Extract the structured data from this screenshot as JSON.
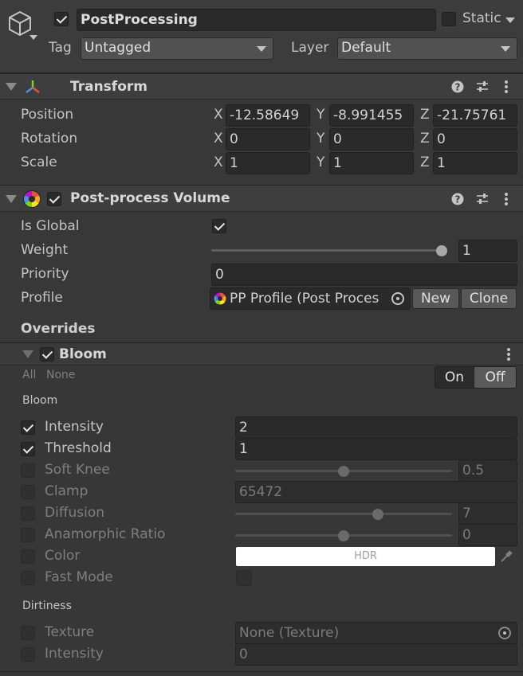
{
  "gameobject": {
    "name": "PostProcessing",
    "active": true,
    "static_label": "Static",
    "static_checked": false,
    "tag_label": "Tag",
    "tag_value": "Untagged",
    "layer_label": "Layer",
    "layer_value": "Default"
  },
  "transform": {
    "title": "Transform",
    "position_label": "Position",
    "rotation_label": "Rotation",
    "scale_label": "Scale",
    "axes": {
      "x": "X",
      "y": "Y",
      "z": "Z"
    },
    "position": {
      "x": "-12.58649",
      "y": "-8.991455",
      "z": "-21.75761"
    },
    "rotation": {
      "x": "0",
      "y": "0",
      "z": "0"
    },
    "scale": {
      "x": "1",
      "y": "1",
      "z": "1"
    }
  },
  "volume": {
    "title": "Post-process Volume",
    "enabled": true,
    "is_global_label": "Is Global",
    "is_global": true,
    "weight_label": "Weight",
    "weight_value": "1",
    "weight_fraction": 1.0,
    "priority_label": "Priority",
    "priority_value": "0",
    "profile_label": "Profile",
    "profile_value": "PP Profile (Post Proces",
    "new_button": "New",
    "clone_button": "Clone",
    "overrides_label": "Overrides"
  },
  "bloom": {
    "title": "Bloom",
    "enabled": true,
    "all_label": "All",
    "none_label": "None",
    "on_label": "On",
    "off_label": "Off",
    "section_bloom": "Bloom",
    "intensity_label": "Intensity",
    "intensity_value": "2",
    "threshold_label": "Threshold",
    "threshold_value": "1",
    "soft_knee_label": "Soft Knee",
    "soft_knee_value": "0.5",
    "soft_knee_fraction": 0.5,
    "clamp_label": "Clamp",
    "clamp_value": "65472",
    "diffusion_label": "Diffusion",
    "diffusion_value": "7",
    "diffusion_fraction": 0.666,
    "anamorphic_label": "Anamorphic Ratio",
    "anamorphic_value": "0",
    "anamorphic_fraction": 0.5,
    "color_label": "Color",
    "color_hdr": "HDR",
    "color_value": "#ffffff",
    "fast_mode_label": "Fast Mode",
    "section_dirtiness": "Dirtiness",
    "texture_label": "Texture",
    "texture_value": "None (Texture)",
    "dirt_intensity_label": "Intensity",
    "dirt_intensity_value": "0"
  }
}
